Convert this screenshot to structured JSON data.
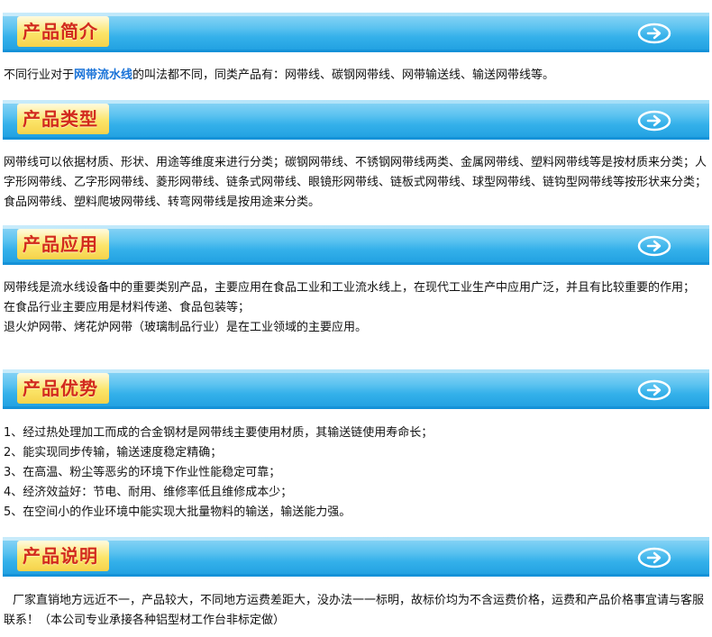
{
  "colors": {
    "header_bar": "#34b0ea",
    "header_title_bg": "#fbe56a",
    "header_title_text": "#d22a1e",
    "highlight_text": "#1a73d8"
  },
  "sections": {
    "intro": {
      "title": "产品简介",
      "text_before": "不同行业对于",
      "highlight": "网带流水线",
      "text_after": "的叫法都不同，同类产品有：网带线、碳钢网带线、网带输送线、输送网带线等。"
    },
    "types": {
      "title": "产品类型",
      "text": "网带线可以依据材质、形状、用途等维度来进行分类；碳钢网带线、不锈钢网带线两类、金属网带线、塑料网带线等是按材质来分类；人字形网带线、乙字形网带线、菱形网带线、链条式网带线、眼镜形网带线、链板式网带线、球型网带线、链钩型网带线等按形状来分类；食品网带线、塑料爬坡网带线、转弯网带线是按用途来分类。"
    },
    "applications": {
      "title": "产品应用",
      "lines": [
        "网带线是流水线设备中的重要类别产品，主要应用在食品工业和工业流水线上，在现代工业生产中应用广泛，并且有比较重要的作用；",
        "在食品行业主要应用是材料传递、食品包装等；",
        "退火炉网带、烤花炉网带（玻璃制品行业）是在工业领域的主要应用。"
      ]
    },
    "advantages": {
      "title": "产品优势",
      "items": [
        "1、经过热处理加工而成的合金钢材是网带线主要使用材质，其输送链使用寿命长；",
        "2、能实现同步传输，输送速度稳定精确；",
        "3、在高温、粉尘等恶劣的环境下作业性能稳定可靠；",
        "4、经济效益好：节电、耐用、维修率低且维修成本少；",
        "5、在空间小的作业环境中能实现大批量物料的输送，输送能力强。"
      ]
    },
    "notes": {
      "title": "产品说明",
      "text": "厂家直销地方远近不一，产品较大，不同地方运费差距大，没办法一一标明，故标价均为不含运费价格，运费和产品价格事宜请与客服联系！（本公司专业承接各种铝型材工作台非标定做）"
    }
  }
}
